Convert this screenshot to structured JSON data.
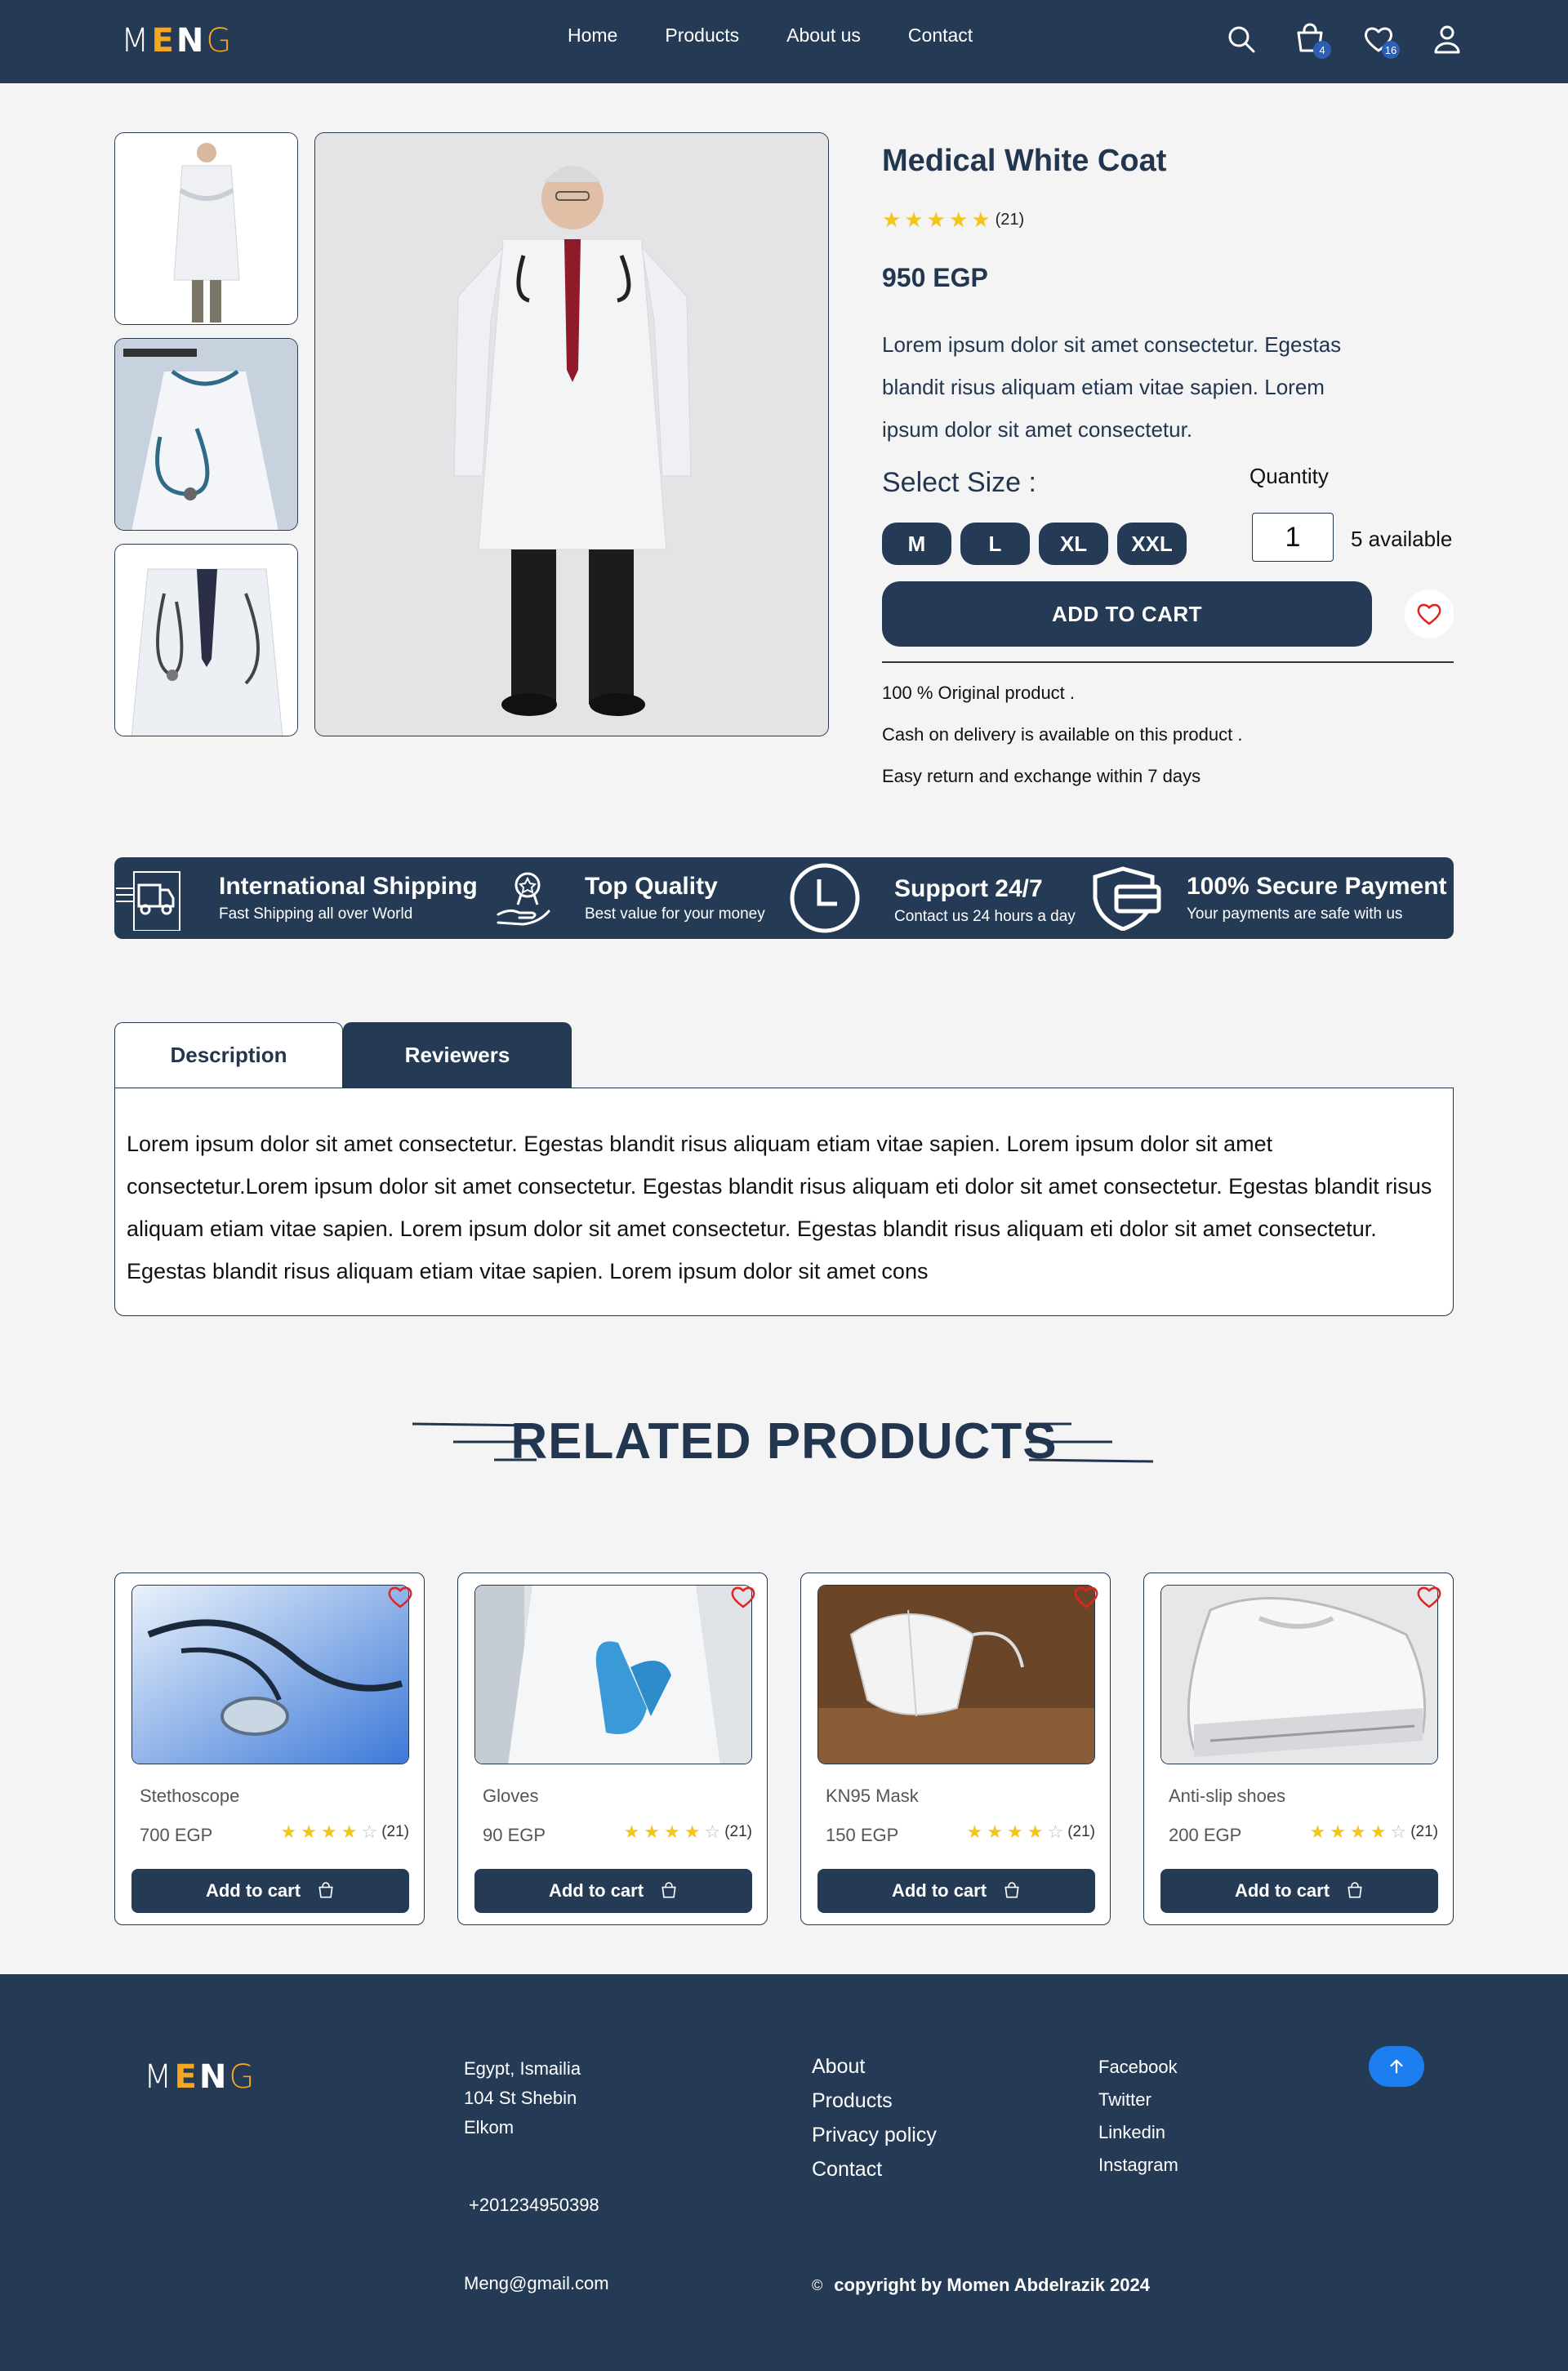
{
  "brand": {
    "letters": [
      "M",
      "E",
      "N",
      "G"
    ],
    "accent": "#f5a623",
    "navy": "#243a55"
  },
  "nav": {
    "links": [
      "Home",
      "Products",
      "About us",
      "Contact"
    ],
    "cart_count": "4",
    "wishlist_count": "16"
  },
  "product": {
    "title": "Medical White Coat",
    "rating_count": "(21)",
    "rating": 5,
    "price": "950 EGP",
    "description": "Lorem ipsum dolor sit amet consectetur. Egestas blandit risus aliquam etiam vitae sapien. Lorem ipsum dolor sit amet consectetur.",
    "size_label": "Select Size :",
    "sizes": [
      "M",
      "L",
      "XL",
      "XXL"
    ],
    "quantity_label": "Quantity",
    "quantity": "1",
    "available": "5 available",
    "add_to_cart": "ADD TO CART",
    "features": [
      "100 % Original product .",
      "Cash on delivery is available on this product .",
      "Easy return and exchange within 7 days"
    ]
  },
  "services": [
    {
      "title": "International  Shipping",
      "subtitle": "Fast Shipping all over World",
      "icon": "truck-icon"
    },
    {
      "title": "Top Quality",
      "subtitle": "Best value for your money",
      "icon": "quality-badge-icon"
    },
    {
      "title": "Support 24/7",
      "subtitle": "Contact us 24 hours a day",
      "icon": "clock-icon"
    },
    {
      "title": "100% Secure Payment",
      "subtitle": "Your payments are safe with us",
      "icon": "shield-card-icon"
    }
  ],
  "tabs": {
    "description_label": "Description",
    "reviewers_label": "Reviewers",
    "description_text": "Lorem ipsum dolor sit amet consectetur. Egestas blandit risus aliquam etiam vitae sapien. Lorem ipsum dolor sit amet consectetur.Lorem ipsum dolor sit amet consectetur. Egestas blandit risus aliquam eti dolor sit amet consectetur. Egestas blandit risus aliquam etiam vitae sapien. Lorem ipsum dolor sit amet consectetur. Egestas blandit risus aliquam eti dolor sit amet consectetur. Egestas blandit risus aliquam etiam vitae sapien. Lorem ipsum dolor sit amet cons"
  },
  "related": {
    "title": "RELATED  PRODUCTS",
    "items": [
      {
        "name": "Stethoscope",
        "price": "700 EGP",
        "rating": 4,
        "count": "(21)",
        "button": "Add to cart"
      },
      {
        "name": "Gloves",
        "price": "90 EGP",
        "rating": 4,
        "count": "(21)",
        "button": "Add to cart"
      },
      {
        "name": "KN95 Mask",
        "price": "150 EGP",
        "rating": 4,
        "count": "(21)",
        "button": "Add to cart"
      },
      {
        "name": "Anti-slip shoes",
        "price": "200 EGP",
        "rating": 4,
        "count": "(21)",
        "button": "Add to cart"
      }
    ]
  },
  "footer": {
    "address": [
      "Egypt, Ismailia",
      "104 St Shebin",
      "Elkom"
    ],
    "phone": "+201234950398",
    "email": "Meng@gmail.com",
    "links": [
      "About",
      "Products",
      "Privacy policy",
      "Contact"
    ],
    "social": [
      "Facebook",
      "Twitter",
      "Linkedin",
      "Instagram"
    ],
    "copyright_symbol": "©",
    "copyright": "copyright by Momen Abdelrazik 2024"
  }
}
